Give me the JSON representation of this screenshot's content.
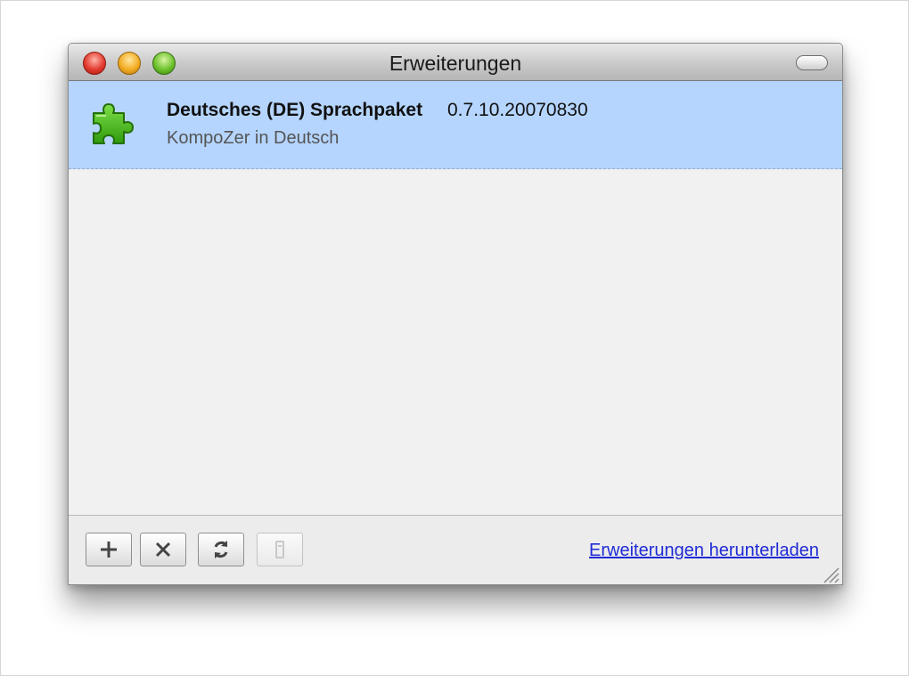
{
  "window": {
    "title": "Erweiterungen"
  },
  "extensions": [
    {
      "name": "Deutsches (DE) Sprachpaket",
      "version": "0.7.10.20070830",
      "description": "KompoZer in Deutsch",
      "icon": "puzzle-piece-icon",
      "selected": true
    }
  ],
  "toolbar": {
    "add_icon": "plus-icon",
    "remove_icon": "x-icon",
    "update_icon": "refresh-icon",
    "disabled_icon": "slot-icon"
  },
  "footer": {
    "download_link_label": "Erweiterungen herunterladen"
  },
  "colors": {
    "selection": "#b5d5fe",
    "link": "#1f2bd6",
    "icon_green": "#3fae14"
  }
}
